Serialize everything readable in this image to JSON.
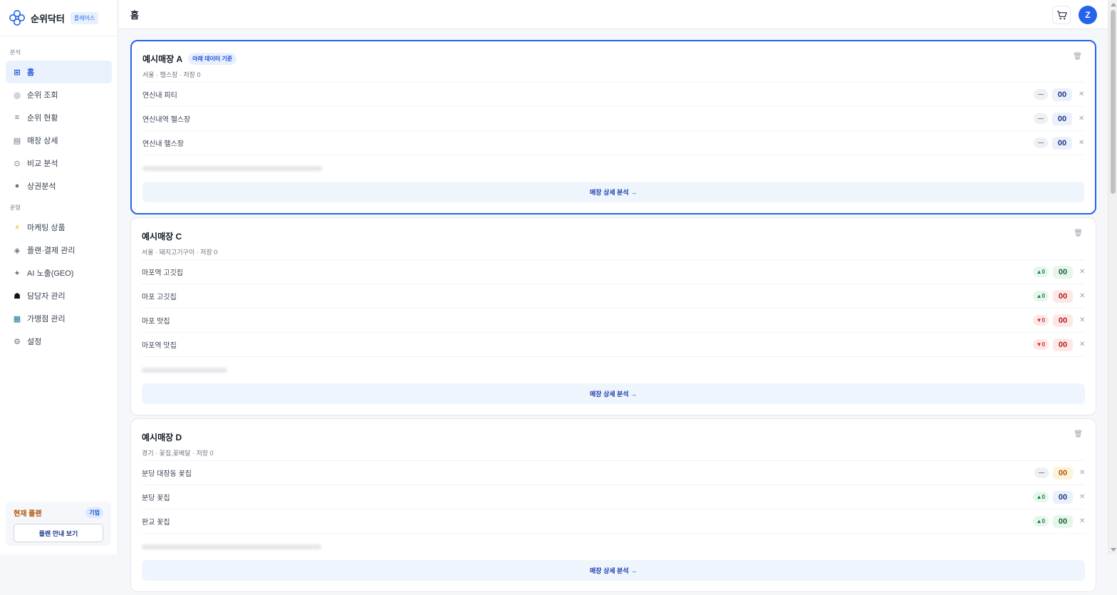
{
  "brand": {
    "name": "순위닥터",
    "badge": "플레이스"
  },
  "nav": {
    "section_analysis": "분석",
    "section_ops": "운영",
    "analysis_items": [
      {
        "label": "홈",
        "icon": "grid-icon"
      },
      {
        "label": "순위 조회",
        "icon": "circle-icon"
      },
      {
        "label": "순위 현황",
        "icon": "list-icon"
      },
      {
        "label": "매장 상세",
        "icon": "store-icon"
      },
      {
        "label": "비교 분석",
        "icon": "clock-icon"
      },
      {
        "label": "상권분석",
        "icon": "dot-icon"
      }
    ],
    "ops_items": [
      {
        "label": "마케팅 상품",
        "icon": "lightning-icon"
      },
      {
        "label": "플랜·결제 관리",
        "icon": "diamond-icon"
      },
      {
        "label": "AI 노출(GEO)",
        "icon": "sparkle-icon"
      },
      {
        "label": "담당자 관리",
        "icon": "people-icon"
      },
      {
        "label": "가맹점 관리",
        "icon": "building-icon"
      },
      {
        "label": "설정",
        "icon": "gear-icon"
      }
    ]
  },
  "plan": {
    "title": "현재 플랜",
    "badge": "기업",
    "button": "플랜 안내 보기"
  },
  "header": {
    "title": "홈",
    "avatar_initial": "Z"
  },
  "stores": [
    {
      "name": "예시매장 A",
      "badge": "아래 데이터 기준",
      "subtitle": "서울 · 헬스장 · 저장 0",
      "keywords": [
        {
          "name": "연신내 피티",
          "delta": "—",
          "delta_type": "flat",
          "rank": "00",
          "rank_color": "blue"
        },
        {
          "name": "연신내역 헬스장",
          "delta": "—",
          "delta_type": "flat",
          "rank": "00",
          "rank_color": "blue"
        },
        {
          "name": "연신내 헬스장",
          "delta": "—",
          "delta_type": "flat",
          "rank": "00",
          "rank_color": "blue"
        }
      ],
      "detail_button": "매장 상세 분석 →"
    },
    {
      "name": "예시매장 C",
      "badge": "",
      "subtitle": "서울 · 돼지고기구이 · 저장 0",
      "keywords": [
        {
          "name": "마포역 고깃집",
          "delta": "▲0",
          "delta_type": "up",
          "rank": "00",
          "rank_color": "green"
        },
        {
          "name": "마포 고깃집",
          "delta": "▲0",
          "delta_type": "up",
          "rank": "00",
          "rank_color": "red"
        },
        {
          "name": "마포 맛집",
          "delta": "▼0",
          "delta_type": "down",
          "rank": "00",
          "rank_color": "red"
        },
        {
          "name": "마포역 맛집",
          "delta": "▼0",
          "delta_type": "down",
          "rank": "00",
          "rank_color": "red"
        }
      ],
      "detail_button": "매장 상세 분석 →"
    },
    {
      "name": "예시매장 D",
      "badge": "",
      "subtitle": "경기 · 꽃집,꽃배달 · 저장 0",
      "keywords": [
        {
          "name": "분당 대장동 꽃집",
          "delta": "—",
          "delta_type": "flat",
          "rank": "00",
          "rank_color": "yellow"
        },
        {
          "name": "분당 꽃집",
          "delta": "▲0",
          "delta_type": "up",
          "rank": "00",
          "rank_color": "blue"
        },
        {
          "name": "판교 꽃집",
          "delta": "▲0",
          "delta_type": "up",
          "rank": "00",
          "rank_color": "green"
        }
      ],
      "detail_button": "매장 상세 분석 →"
    }
  ]
}
